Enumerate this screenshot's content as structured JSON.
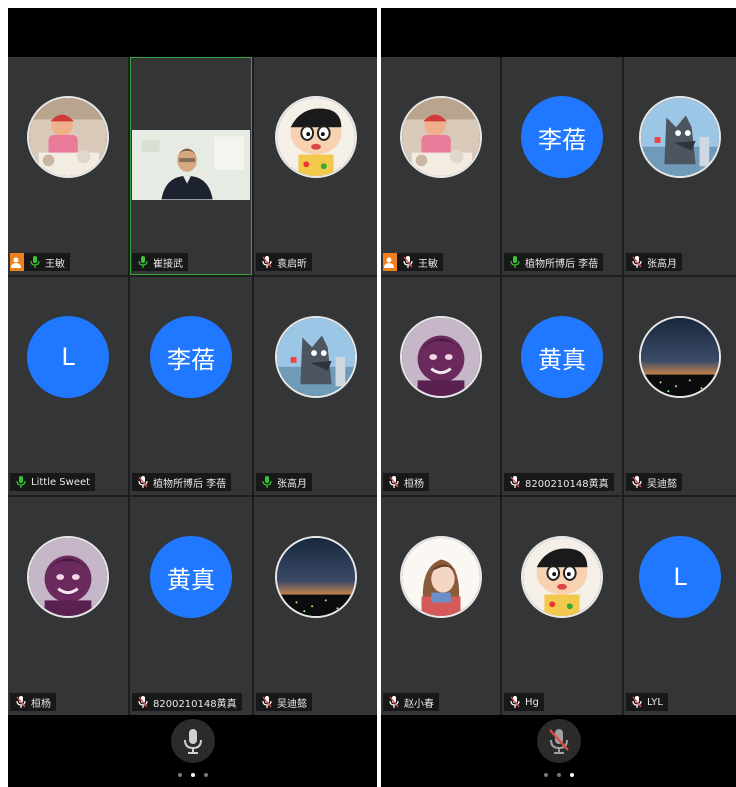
{
  "colors": {
    "accent": "#1f78ff",
    "host_badge": "#f0801e",
    "active_border": "#37a537",
    "mic_on": "#37c537",
    "mic_muted": "#e24a4a"
  },
  "left_panel": {
    "participants": [
      {
        "name": "王敏",
        "avatar_type": "photo",
        "avatar_icon": "child-photo-avatar",
        "host": true,
        "mic": "on"
      },
      {
        "name": "崔接武",
        "avatar_type": "video",
        "avatar_icon": "man-video-feed",
        "host": false,
        "mic": "on",
        "active": true
      },
      {
        "name": "袁启昕",
        "avatar_type": "photo",
        "avatar_icon": "cartoon-boy-avatar",
        "host": false,
        "mic": "muted"
      },
      {
        "name": "Little Sweet",
        "avatar_type": "letter",
        "avatar_text": "L",
        "host": false,
        "mic": "on"
      },
      {
        "name": "植物所博后 李蓓",
        "avatar_type": "letter",
        "avatar_text": "李蓓",
        "host": false,
        "mic": "muted"
      },
      {
        "name": "张高月",
        "avatar_type": "photo",
        "avatar_icon": "wolf-avatar",
        "host": false,
        "mic": "on"
      },
      {
        "name": "桓杨",
        "avatar_type": "photo",
        "avatar_icon": "purple-cartoon-avatar",
        "host": false,
        "mic": "muted"
      },
      {
        "name": "8200210148黄真",
        "avatar_type": "letter",
        "avatar_text": "黄真",
        "host": false,
        "mic": "muted"
      },
      {
        "name": "吴迪懿",
        "avatar_type": "photo",
        "avatar_icon": "sunset-city-avatar",
        "host": false,
        "mic": "muted"
      }
    ],
    "page_dots": [
      false,
      true,
      false
    ]
  },
  "right_panel": {
    "participants": [
      {
        "name": "王敏",
        "avatar_type": "photo",
        "avatar_icon": "child-photo-avatar",
        "host": true,
        "mic": "muted"
      },
      {
        "name": "植物所博后 李蓓",
        "avatar_type": "letter",
        "avatar_text": "李蓓",
        "host": false,
        "mic": "on"
      },
      {
        "name": "张高月",
        "avatar_type": "photo",
        "avatar_icon": "wolf-avatar",
        "host": false,
        "mic": "muted"
      },
      {
        "name": "桓杨",
        "avatar_type": "photo",
        "avatar_icon": "purple-cartoon-avatar",
        "host": false,
        "mic": "muted"
      },
      {
        "name": "8200210148黄真",
        "avatar_type": "letter",
        "avatar_text": "黄真",
        "host": false,
        "mic": "muted"
      },
      {
        "name": "吴迪懿",
        "avatar_type": "photo",
        "avatar_icon": "sunset-city-avatar",
        "host": false,
        "mic": "muted"
      },
      {
        "name": "赵小春",
        "avatar_type": "photo",
        "avatar_icon": "girl-drawing-avatar",
        "host": false,
        "mic": "muted"
      },
      {
        "name": "Hg",
        "avatar_type": "photo",
        "avatar_icon": "cartoon-boy-avatar",
        "host": false,
        "mic": "muted"
      },
      {
        "name": "LYL",
        "avatar_type": "letter",
        "avatar_text": "L",
        "host": false,
        "mic": "muted"
      }
    ],
    "page_dots": [
      false,
      false,
      true
    ]
  },
  "toolbar": {
    "left_mic_icon": "microphone-icon",
    "right_mic_icon": "microphone-muted-icon"
  }
}
